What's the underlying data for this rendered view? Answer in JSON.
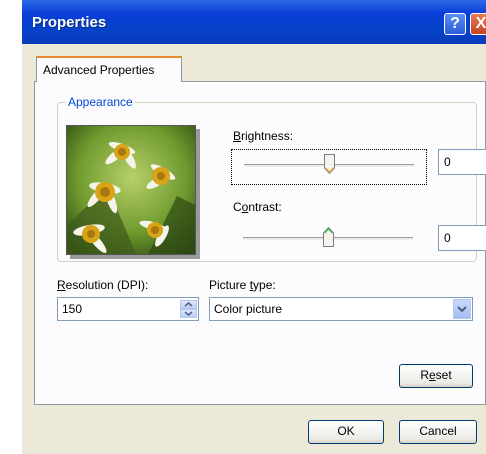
{
  "window": {
    "title": "Properties",
    "help_label": "?",
    "close_label": "X"
  },
  "tabs": [
    {
      "label": "Advanced Properties",
      "selected": true
    }
  ],
  "appearance": {
    "label": "Appearance",
    "brightness": {
      "label_first": "B",
      "label_rest": "rightness:",
      "value": "0",
      "level": 0.5
    },
    "contrast": {
      "label_pre": "C",
      "label_u": "o",
      "label_rest": "ntrast:",
      "value": "0",
      "level": 0.5
    }
  },
  "resolution": {
    "label_first": "R",
    "label_rest": "esolution (DPI):",
    "value": "150"
  },
  "picture_type": {
    "label_pre": "Picture ",
    "label_u": "t",
    "label_rest": "ype:",
    "value": "Color picture"
  },
  "buttons": {
    "reset_pre": "R",
    "reset_u": "e",
    "reset_rest": "set",
    "ok": "OK",
    "cancel": "Cancel"
  },
  "colors": {
    "titlebar": "#0a3ed8",
    "accent_tab": "#e68b2c",
    "group_label": "#0046d5",
    "dialog_bg": "#ece9d8"
  }
}
